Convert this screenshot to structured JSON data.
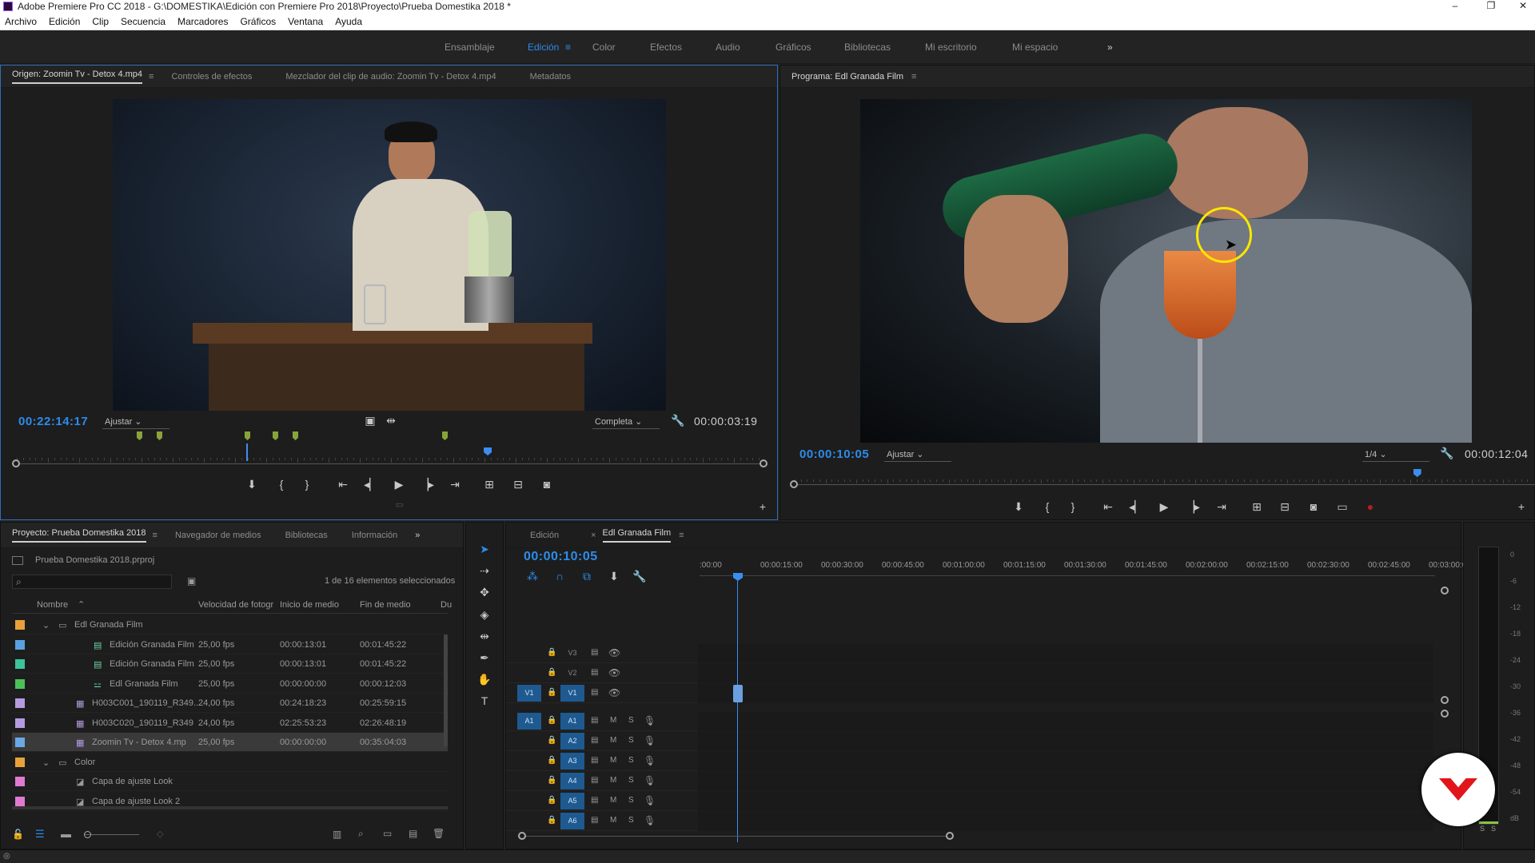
{
  "window": {
    "title": "Adobe Premiere Pro CC 2018 - G:\\DOMESTIKA\\Edición con Premiere Pro 2018\\Proyecto\\Prueba Domestika 2018 *"
  },
  "menu": [
    "Archivo",
    "Edición",
    "Clip",
    "Secuencia",
    "Marcadores",
    "Gráficos",
    "Ventana",
    "Ayuda"
  ],
  "workspaces": [
    "Ensamblaje",
    "Edición",
    "Color",
    "Efectos",
    "Audio",
    "Gráficos",
    "Bibliotecas",
    "Mi escritorio",
    "Mi espacio"
  ],
  "workspace_active": "Edición",
  "source": {
    "tabs": [
      "Origen: Zoomin Tv - Detox 4.mp4",
      "Controles de efectos",
      "Mezclador del clip de audio: Zoomin Tv - Detox 4.mp4",
      "Metadatos"
    ],
    "timecode": "00:22:14:17",
    "fit": "Ajustar",
    "resolution": "Completa",
    "duration": "00:00:03:19",
    "playhead_fraction": 0.63
  },
  "program": {
    "tab": "Programa: Edl Granada Film",
    "timecode": "00:00:10:05",
    "fit": "Ajustar",
    "resolution": "1/4",
    "duration": "00:00:12:04",
    "playhead_fraction": 0.84
  },
  "project": {
    "tabs": [
      "Proyecto: Prueba Domestika 2018",
      "Navegador de medios",
      "Bibliotecas",
      "Información"
    ],
    "file": "Prueba Domestika 2018.prproj",
    "selection": "1 de 16 elementos seleccionados",
    "columns": [
      "Nombre",
      "Velocidad de fotogr",
      "Inicio de medio",
      "Fin de medio",
      "Du"
    ],
    "rows": [
      {
        "color": "#e8a13a",
        "name": "Edl Granada Film",
        "fps": "",
        "start": "",
        "end": "",
        "indent": 0,
        "icon": "folder"
      },
      {
        "color": "#5aa0e0",
        "name": "Edición Granada Film",
        "fps": "25,00 fps",
        "start": "00:00:13:01",
        "end": "00:01:45:22",
        "indent": 2,
        "icon": "sequence"
      },
      {
        "color": "#3cc49a",
        "name": "Edición Granada Film",
        "fps": "25,00 fps",
        "start": "00:00:13:01",
        "end": "00:01:45:22",
        "indent": 2,
        "icon": "sequence"
      },
      {
        "color": "#4cbf5a",
        "name": "Edl Granada Film",
        "fps": "25,00 fps",
        "start": "00:00:00:00",
        "end": "00:00:12:03",
        "indent": 2,
        "icon": "multicam"
      },
      {
        "color": "#b49be0",
        "name": "H003C001_190119_R349...",
        "fps": "24,00 fps",
        "start": "00:24:18:23",
        "end": "00:25:59:15",
        "indent": 1,
        "icon": "clip"
      },
      {
        "color": "#b49be0",
        "name": "H003C020_190119_R349",
        "fps": "24,00 fps",
        "start": "02:25:53:23",
        "end": "02:26:48:19",
        "indent": 1,
        "icon": "clip"
      },
      {
        "color": "#6aa8e8",
        "name": "Zoomin Tv - Detox 4.mp",
        "fps": "25,00 fps",
        "start": "00:00:00:00",
        "end": "00:35:04:03",
        "indent": 1,
        "icon": "clip",
        "selected": true
      },
      {
        "color": "#e8a13a",
        "name": "Color",
        "fps": "",
        "start": "",
        "end": "",
        "indent": 0,
        "icon": "folder"
      },
      {
        "color": "#e07ad0",
        "name": "Capa de ajuste Look",
        "fps": "",
        "start": "",
        "end": "",
        "indent": 1,
        "icon": "adjust"
      },
      {
        "color": "#e07ad0",
        "name": "Capa de ajuste Look 2",
        "fps": "",
        "start": "",
        "end": "",
        "indent": 1,
        "icon": "adjust"
      }
    ]
  },
  "timeline": {
    "tabs": [
      "Edición",
      "Edl Granada Film"
    ],
    "timecode": "00:00:10:05",
    "ruler": [
      ":00:00",
      "00:00:15:00",
      "00:00:30:00",
      "00:00:45:00",
      "00:01:00:00",
      "00:01:15:00",
      "00:01:30:00",
      "00:01:45:00",
      "00:02:00:00",
      "00:02:15:00",
      "00:02:30:00",
      "00:02:45:00",
      "00:03:00:0"
    ],
    "video_tracks": [
      "V3",
      "V2",
      "V1"
    ],
    "audio_tracks": [
      "A1",
      "A2",
      "A3",
      "A4",
      "A5",
      "A6"
    ],
    "src_v": "V1",
    "src_a": "A1",
    "m": "M",
    "s": "S"
  },
  "meter": {
    "labels": [
      "0",
      "-6",
      "-12",
      "-18",
      "-24",
      "-30",
      "-36",
      "-42",
      "-48",
      "-54",
      "dB"
    ],
    "solo": [
      "S",
      "S"
    ]
  },
  "colors": {
    "accent": "#2d8ceb",
    "playhead": "#3b8ef0",
    "marker": "#8aa23a"
  },
  "icons": [
    "selection-tool-icon",
    "track-select-icon",
    "ripple-edit-icon",
    "razor-icon",
    "slip-icon",
    "pen-icon",
    "hand-icon",
    "type-icon",
    "wrench-icon",
    "marker-icon",
    "play-icon",
    "camera-icon",
    "eye-icon",
    "lock-icon",
    "mic-icon",
    "search-icon"
  ]
}
